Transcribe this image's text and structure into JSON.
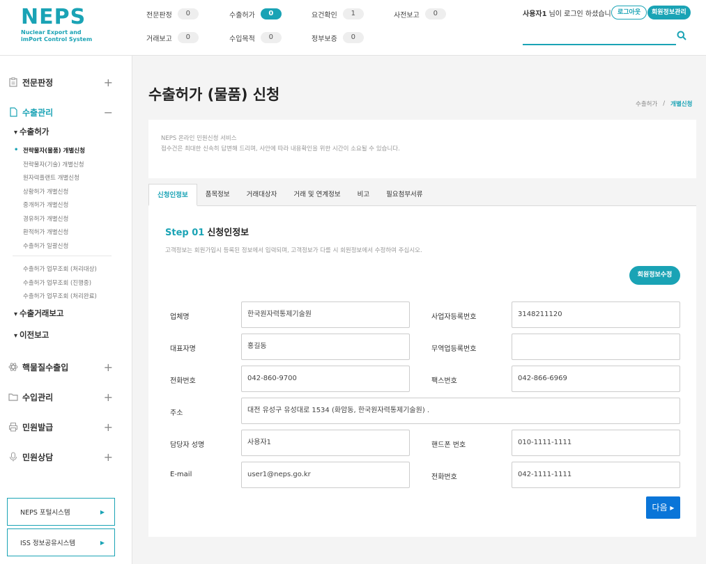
{
  "brand": {
    "name": "NEPS",
    "sub1": "Nuclear Export and",
    "sub2": "imPort Control System",
    "color": "#1aa3b5"
  },
  "header": {
    "stats": [
      {
        "label": "전문판정",
        "count": "0"
      },
      {
        "label": "수출허가",
        "count": "0",
        "active": true
      },
      {
        "label": "요건확인",
        "count": "1"
      },
      {
        "label": "사전보고",
        "count": "0"
      },
      {
        "label": "거래보고",
        "count": "0"
      },
      {
        "label": "수입목적",
        "count": "0"
      },
      {
        "label": "정부보증",
        "count": "0"
      }
    ],
    "user_name": "사용자1",
    "user_suffix": "님이 로그인 하셨습니다.",
    "logout_label": "로그아웃",
    "member_label": "회원정보관리",
    "search_placeholder": ""
  },
  "sidebar": {
    "menus": [
      {
        "label": "전문판정",
        "toggle": "+",
        "icon": "clipboard-icon"
      },
      {
        "label": "수출관리",
        "toggle": "−",
        "icon": "document-icon"
      },
      {
        "label": "핵물질수출입",
        "toggle": "+",
        "icon": "atom-icon"
      },
      {
        "label": "수입관리",
        "toggle": "+",
        "icon": "folder-icon"
      },
      {
        "label": "민원발급",
        "toggle": "+",
        "icon": "printer-icon"
      },
      {
        "label": "민원상담",
        "toggle": "+",
        "icon": "microphone-icon"
      }
    ],
    "sub_heads": [
      "수출허가",
      "수출거래보고",
      "이전보고"
    ],
    "leaves": [
      "전략물자(물품) 개별신청",
      "전략물자(기술) 개별신청",
      "원자력플랜트 개별신청",
      "상황허가 개별신청",
      "중개허가 개별신청",
      "경유허가 개별신청",
      "환적허가 개별신청",
      "수출허가 일괄신청",
      "수출허가 업무조회 (처리대상)",
      "수출허가 업무조회 (진행중)",
      "수출허가 업무조회 (처리완료)"
    ],
    "systems": [
      "NEPS 포털시스템",
      "ISS 정보공유시스템"
    ]
  },
  "main": {
    "title": "수출허가 (물품) 신청",
    "breadcrumb": [
      "수출허가",
      "개별신청"
    ],
    "notice_line1": "NEPS 온라인 민원신청 서비스",
    "notice_line2": "접수건은 최대한 신속히 답변해 드리며, 사안에 따라 내용확인을 위한 시간이 소요될 수 있습니다.",
    "tabs": [
      "신청인정보",
      "품목정보",
      "거래대상자",
      "거래 및 연계정보",
      "비고",
      "필요첨부서류"
    ],
    "step_num": "Step 01",
    "step_title": "신청인정보",
    "step_desc": "고객정보는 회원가입시 등록된 정보에서 입력되며, 고객정보가 다를 시 회원정보에서 수정하여 주십시오.",
    "edit_label": "회원정보수정",
    "fields": {
      "company": {
        "label": "업체명",
        "value": "한국원자력통제기술원"
      },
      "bizno": {
        "label": "사업자등록번호",
        "value": "3148211120"
      },
      "ceo": {
        "label": "대표자명",
        "value": "홍길동"
      },
      "tradeno": {
        "label": "무역업등록번호",
        "value": ""
      },
      "phone": {
        "label": "전화번호",
        "value": "042-860-9700"
      },
      "fax": {
        "label": "팩스번호",
        "value": "042-866-6969"
      },
      "address": {
        "label": "주소",
        "value": "대전 유성구 유성대로 1534 (화암동, 한국원자력통제기술원) ."
      },
      "manager": {
        "label": "담당자 성명",
        "value": "사용자1"
      },
      "mobile": {
        "label": "핸드폰 번호",
        "value": "010-1111-1111"
      },
      "email": {
        "label": "E-mail",
        "value": "user1@neps.go.kr"
      },
      "phone2": {
        "label": "전화번호",
        "value": "042-1111-1111"
      }
    },
    "next_label": "다음 ▸"
  }
}
